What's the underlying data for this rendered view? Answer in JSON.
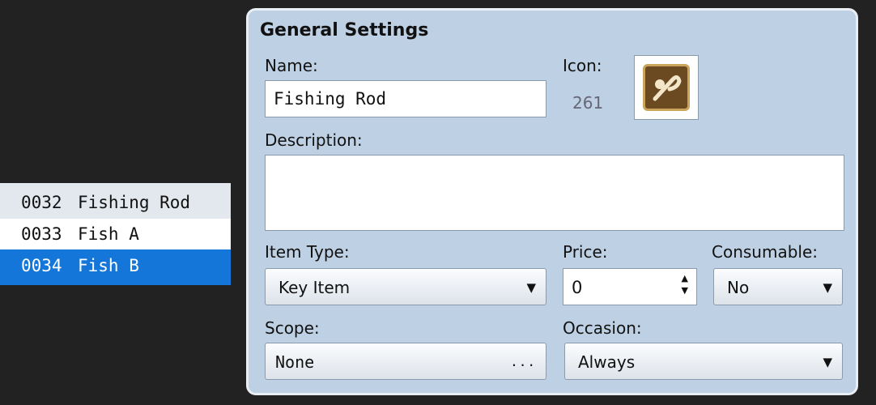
{
  "item_list": [
    {
      "id": "0032",
      "name": "Fishing Rod",
      "state": "alt"
    },
    {
      "id": "0033",
      "name": "Fish A",
      "state": "normal"
    },
    {
      "id": "0034",
      "name": "Fish B",
      "state": "selected"
    }
  ],
  "general": {
    "title": "General Settings",
    "name_label": "Name:",
    "name_value": "Fishing Rod",
    "icon_label": "Icon:",
    "icon_index": "261",
    "description_label": "Description:",
    "description_value": "",
    "item_type_label": "Item Type:",
    "item_type_value": "Key Item",
    "price_label": "Price:",
    "price_value": "0",
    "consumable_label": "Consumable:",
    "consumable_value": "No",
    "scope_label": "Scope:",
    "scope_value": "None",
    "scope_more": "...",
    "occasion_label": "Occasion:",
    "occasion_value": "Always"
  },
  "icons": {
    "dropdown": "triangle-down",
    "spinner": "up-down-arrows",
    "item_icon": "fishing-rod-icon"
  },
  "colors": {
    "selection": "#1476d8",
    "panel_bg": "#bed0e3"
  }
}
